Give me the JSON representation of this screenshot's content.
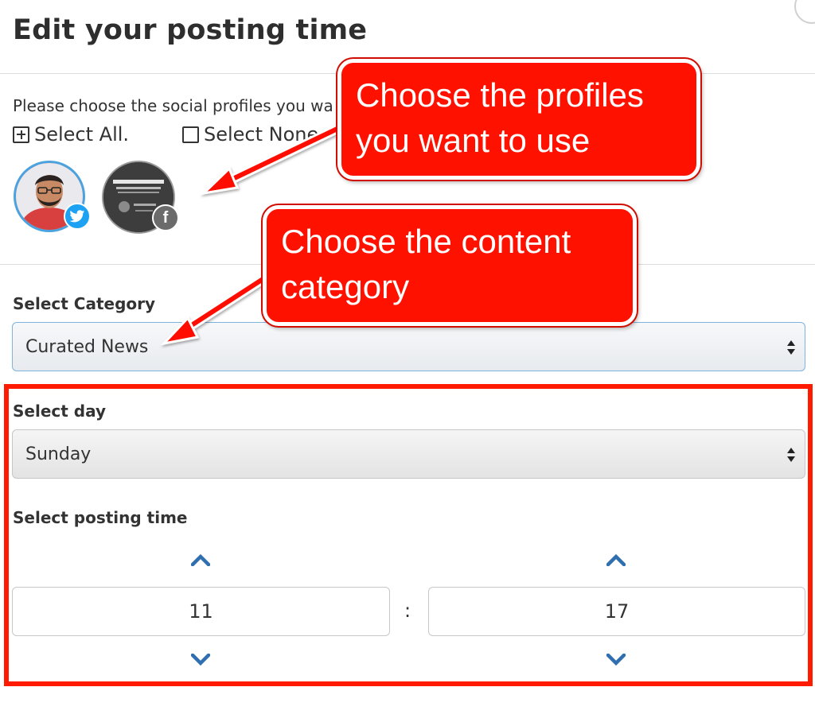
{
  "dialog": {
    "title": "Edit your posting time"
  },
  "profiles": {
    "instruction": "Please choose the social profiles you wa",
    "select_all_label": "Select All.",
    "select_none_label": "Select None."
  },
  "category": {
    "label": "Select Category",
    "selected": "Curated News"
  },
  "day": {
    "label": "Select day",
    "selected": "Sunday"
  },
  "posting_time": {
    "label": "Select posting time",
    "hour": "11",
    "minute": "17",
    "separator": ":"
  },
  "annotations": {
    "profiles_line1": "Choose the profiles",
    "profiles_line2": "you want to use",
    "category_line1": "Choose the content",
    "category_line2": "category"
  },
  "colors": {
    "annotation_red": "#ff1100",
    "chevron_blue": "#2f6fb0",
    "twitter_blue": "#1da1f2",
    "select_focus_border": "#7fb3da"
  },
  "icons": {
    "select_all": "plus-square-icon",
    "select_none": "empty-square-icon",
    "twitter_badge": "twitter-icon",
    "facebook_badge": "facebook-icon",
    "increment": "chevron-up-icon",
    "decrement": "chevron-down-icon",
    "dropdown": "up-down-arrows-icon"
  }
}
